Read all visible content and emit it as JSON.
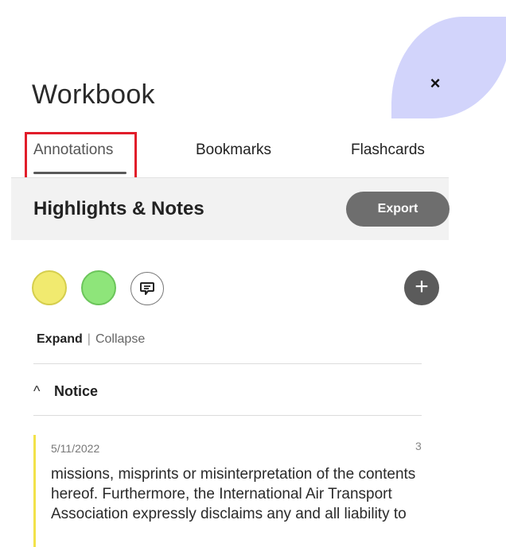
{
  "panel": {
    "title": "Workbook",
    "close_label": "×"
  },
  "tabs": [
    {
      "label": "Annotations",
      "active": true
    },
    {
      "label": "Bookmarks",
      "active": false
    },
    {
      "label": "Flashcards",
      "active": false
    }
  ],
  "section": {
    "title": "Highlights & Notes",
    "export_label": "Export"
  },
  "filters": {
    "swatches": [
      {
        "name": "yellow",
        "color": "#f1ea6f"
      },
      {
        "name": "green",
        "color": "#8ee57a"
      }
    ],
    "note_icon": "comment-icon",
    "add_icon": "plus-icon",
    "add_label": "+"
  },
  "controls": {
    "expand_label": "Expand",
    "separator": "|",
    "collapse_label": "Collapse"
  },
  "group": {
    "chevron": "^",
    "title": "Notice"
  },
  "entry": {
    "date": "5/11/2022",
    "page": "3",
    "highlight_color": "#f2e24a",
    "text": "missions, misprints or misinterpretation of the contents hereof. Furthermore, the International Air Transport Association expressly disclaims any and all liability to"
  },
  "colors": {
    "accent_highlight_box": "#e11d2a",
    "decorative_blob": "#d2d4fb"
  }
}
